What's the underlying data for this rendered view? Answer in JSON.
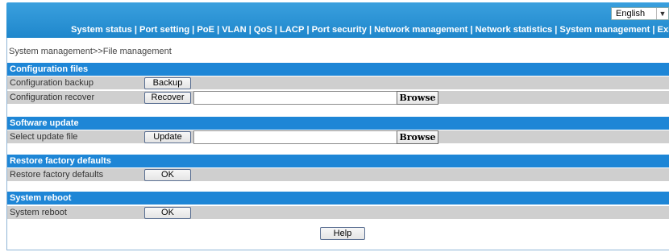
{
  "header": {
    "language": "English",
    "nav": [
      "System status",
      "Port setting",
      "PoE",
      "VLAN",
      "QoS",
      "LACP",
      "Port security",
      "Network management",
      "Network statistics",
      "System management",
      "Exit"
    ]
  },
  "breadcrumb": "System management>>File management",
  "sections": {
    "config": {
      "title": "Configuration files",
      "backup_label": "Configuration backup",
      "backup_button": "Backup",
      "recover_label": "Configuration recover",
      "recover_button": "Recover",
      "recover_file_value": "",
      "browse_label": "Browse"
    },
    "software": {
      "title": "Software update",
      "select_label": "Select update file",
      "update_button": "Update",
      "update_file_value": "",
      "browse_label": "Browse"
    },
    "factory": {
      "title": "Restore factory defaults",
      "label": "Restore factory defaults",
      "button": "OK"
    },
    "reboot": {
      "title": "System reboot",
      "label": "System reboot",
      "button": "OK"
    }
  },
  "help_button": "Help"
}
